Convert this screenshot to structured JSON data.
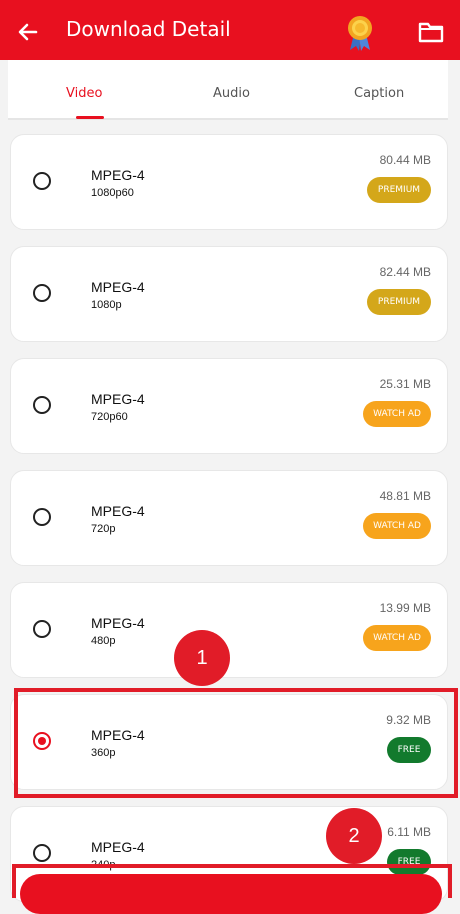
{
  "header": {
    "title": "Download Detail",
    "bg_color": "#e8101f"
  },
  "tabs": [
    {
      "label": "Video",
      "active": true
    },
    {
      "label": "Audio",
      "active": false
    },
    {
      "label": "Caption",
      "active": false
    }
  ],
  "options": [
    {
      "format": "MPEG-4",
      "resolution": "1080p60",
      "size": "80.44 MB",
      "badge": "PREMIUM",
      "badge_color": "#d4a71a",
      "selected": false
    },
    {
      "format": "MPEG-4",
      "resolution": "1080p",
      "size": "82.44 MB",
      "badge": "PREMIUM",
      "badge_color": "#d4a71a",
      "selected": false
    },
    {
      "format": "MPEG-4",
      "resolution": "720p60",
      "size": "25.31 MB",
      "badge": "WATCH AD",
      "badge_color": "#f7a41c",
      "selected": false
    },
    {
      "format": "MPEG-4",
      "resolution": "720p",
      "size": "48.81 MB",
      "badge": "WATCH AD",
      "badge_color": "#f7a41c",
      "selected": false
    },
    {
      "format": "MPEG-4",
      "resolution": "480p",
      "size": "13.99 MB",
      "badge": "WATCH AD",
      "badge_color": "#f7a41c",
      "selected": false
    },
    {
      "format": "MPEG-4",
      "resolution": "360p",
      "size": "9.32 MB",
      "badge": "FREE",
      "badge_color": "#127a2d",
      "selected": true
    },
    {
      "format": "MPEG-4",
      "resolution": "240p",
      "size": "6.11 MB",
      "badge": "FREE",
      "badge_color": "#127a2d",
      "selected": false
    }
  ],
  "markers": [
    "1",
    "2"
  ],
  "accent_color": "#e8101f"
}
